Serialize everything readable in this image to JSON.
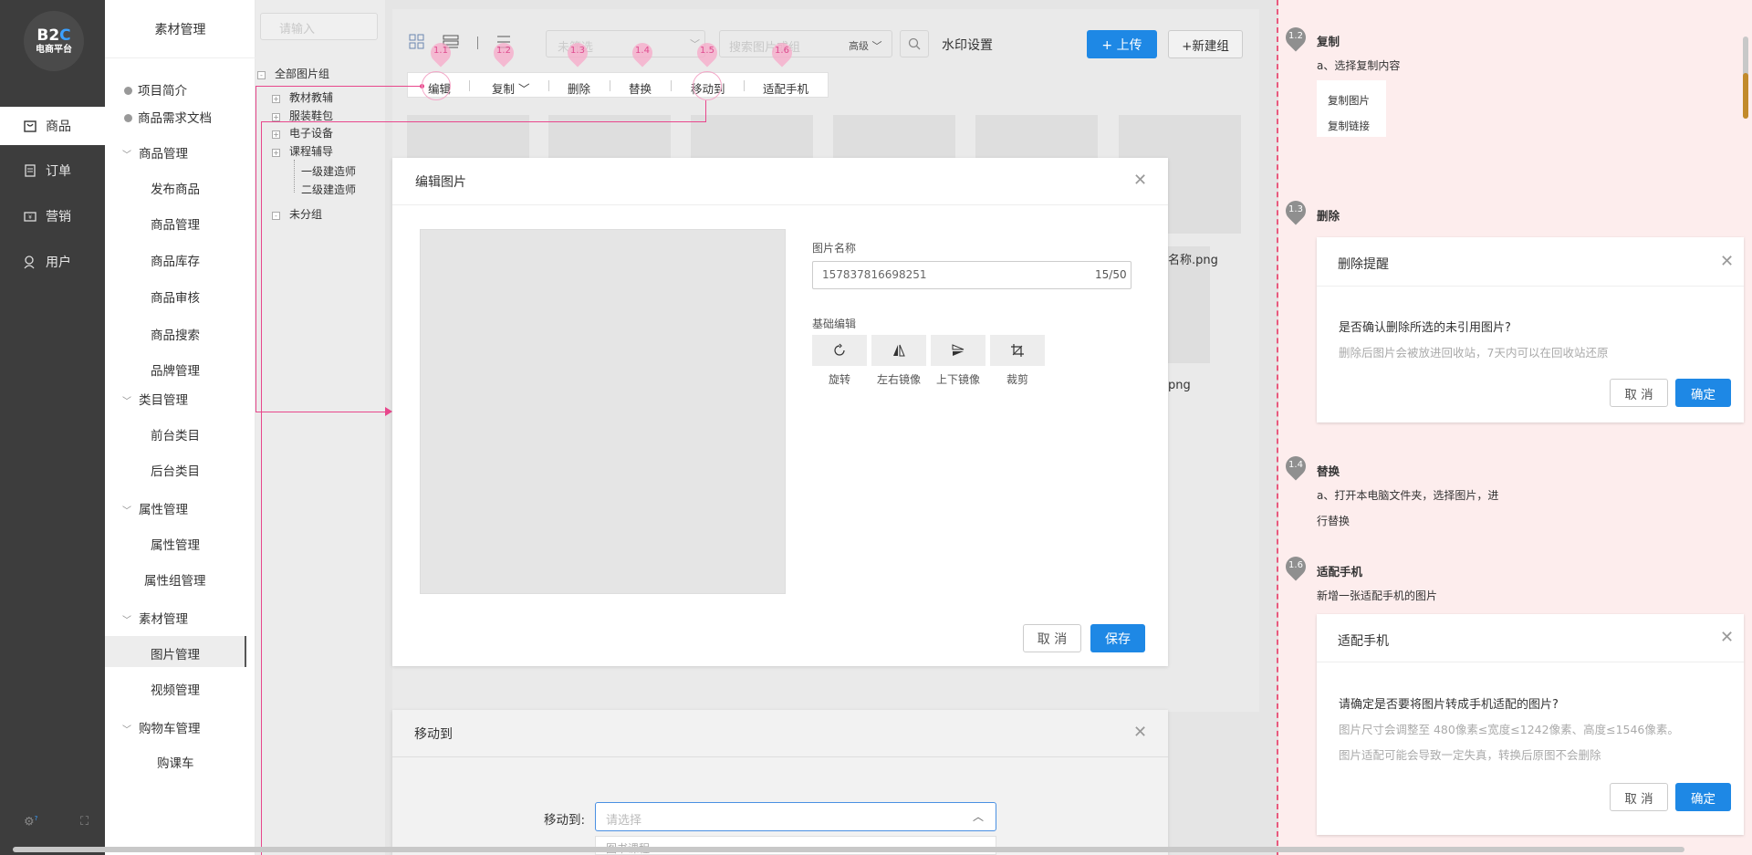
{
  "logo": {
    "brand_b": "B2",
    "brand_c": "C",
    "subtitle": "电商平台"
  },
  "rail": {
    "items": [
      {
        "label": "商品",
        "icon": "bag-icon"
      },
      {
        "label": "订单",
        "icon": "order-icon"
      },
      {
        "label": "营销",
        "icon": "marketing-icon"
      },
      {
        "label": "用户",
        "icon": "user-icon"
      }
    ],
    "help_badge": "?"
  },
  "menu": {
    "title": "素材管理",
    "items": {
      "intro": "项目简介",
      "requirements": "商品需求文档",
      "goods_mgmt": "商品管理",
      "publish": "发布商品",
      "goods_mgmt_sub": "商品管理",
      "stock": "商品库存",
      "audit": "商品审核",
      "search": "商品搜索",
      "brand": "品牌管理",
      "category_mgmt": "类目管理",
      "front_cat": "前台类目",
      "back_cat": "后台类目",
      "attr_mgmt": "属性管理",
      "attr_mgmt_sub": "属性管理",
      "attr_group": "属性组管理",
      "material_mgmt": "素材管理",
      "image_mgmt": "图片管理",
      "video_mgmt": "视频管理",
      "cart_mgmt": "购物车管理",
      "course_cart": "购课车"
    }
  },
  "tree": {
    "search_placeholder": "请输入",
    "root": "全部图片组",
    "nodes": [
      "教材教辅",
      "服装鞋包",
      "电子设备",
      "课程辅导"
    ],
    "children": [
      "一级建造师",
      "二级建造师"
    ],
    "ungrouped": "未分组"
  },
  "toolbar": {
    "filter_placeholder": "未筛选",
    "search_placeholder": "搜索图片或组",
    "advanced": "高级",
    "watermark": "水印设置",
    "upload": "+ 上传",
    "new_group": "+新建组"
  },
  "actions": [
    "编辑",
    "复制",
    "删除",
    "替换",
    "移动到",
    "适配手机"
  ],
  "pins": [
    "1.1",
    "1.2",
    "1.3",
    "1.4",
    "1.5",
    "1.6"
  ],
  "thumb_labels": {
    "a": "名称.png",
    "b": "png"
  },
  "edit_modal": {
    "title": "编辑图片",
    "name_label": "图片名称",
    "name_value": "157837816698251",
    "name_count": "15/50",
    "basic_label": "基础编辑",
    "tools": [
      {
        "label": "旋转",
        "icon": "rotate-icon"
      },
      {
        "label": "左右镜像",
        "icon": "flip-horizontal-icon"
      },
      {
        "label": "上下镜像",
        "icon": "flip-vertical-icon"
      },
      {
        "label": "裁剪",
        "icon": "crop-icon"
      }
    ],
    "cancel": "取 消",
    "save": "保存"
  },
  "move_modal": {
    "title": "移动到",
    "label": "移动到:",
    "placeholder": "请选择",
    "first_option": "图书课程"
  },
  "notes": {
    "copy": {
      "num": "1.2",
      "title": "复制",
      "desc": "a、选择复制内容",
      "options": [
        "复制图片",
        "复制链接"
      ]
    },
    "delete": {
      "num": "1.3",
      "title": "删除",
      "dialog_title": "删除提醒",
      "question": "是否确认删除所选的未引用图片?",
      "hint": "删除后图片会被放进回收站，7天内可以在回收站还原",
      "cancel": "取 消",
      "ok": "确定"
    },
    "replace": {
      "num": "1.4",
      "title": "替换",
      "desc1": "a、打开本电脑文件夹，选择图片，进",
      "desc2": "行替换"
    },
    "adapt": {
      "num": "1.6",
      "title": "适配手机",
      "desc": "新增一张适配手机的图片",
      "dialog_title": "适配手机",
      "question": "请确定是否要将图片转成手机适配的图片?",
      "hint1": "图片尺寸会调整至 480像素≤宽度≤1242像素、高度≤1546像素。",
      "hint2": "图片适配可能会导致一定失真，转换后原图不会删除",
      "cancel": "取 消",
      "ok": "确定"
    }
  },
  "colors": {
    "accent": "#1e88e5",
    "annotation_pink": "#e8478c",
    "rail_bg": "#3d3d3d",
    "note_bg": "#fdeded"
  }
}
